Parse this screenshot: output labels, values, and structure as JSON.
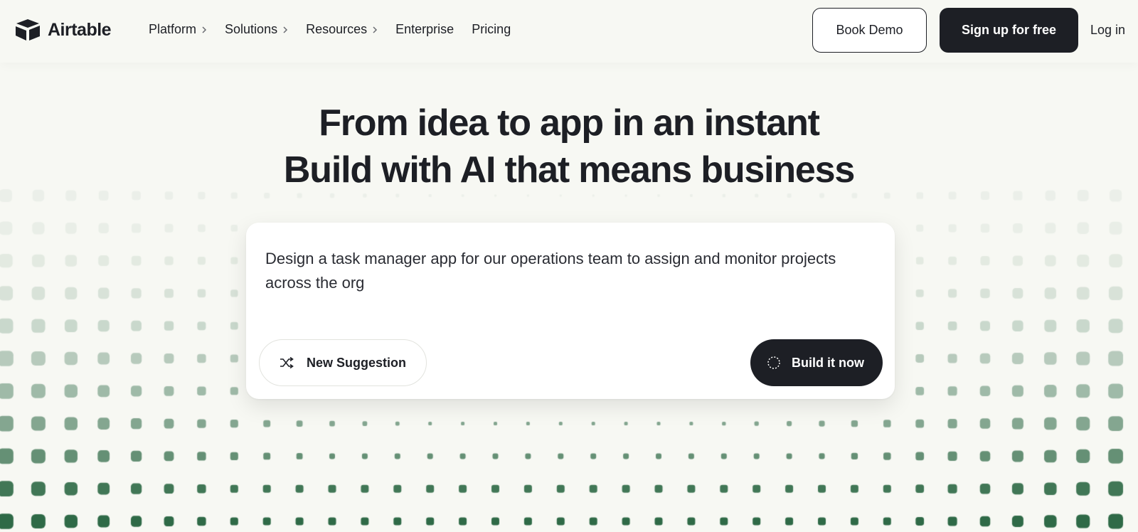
{
  "header": {
    "logo_text": "Airtable",
    "nav": [
      {
        "label": "Platform",
        "has_submenu": true
      },
      {
        "label": "Solutions",
        "has_submenu": true
      },
      {
        "label": "Resources",
        "has_submenu": true
      },
      {
        "label": "Enterprise",
        "has_submenu": false
      },
      {
        "label": "Pricing",
        "has_submenu": false
      }
    ],
    "book_demo": "Book Demo",
    "sign_up": "Sign up for free",
    "log_in": "Log in"
  },
  "hero": {
    "line1": "From idea to app in an instant",
    "line2": "Build with AI that means business"
  },
  "prompt": {
    "text": "Design a task manager app for our operations team to assign and monitor projects across the org",
    "new_suggestion": "New Suggestion",
    "build": "Build it now"
  },
  "colors": {
    "background": "#f7f8f3",
    "dark": "#1d1f25",
    "dot_green": "#2f6a47"
  }
}
